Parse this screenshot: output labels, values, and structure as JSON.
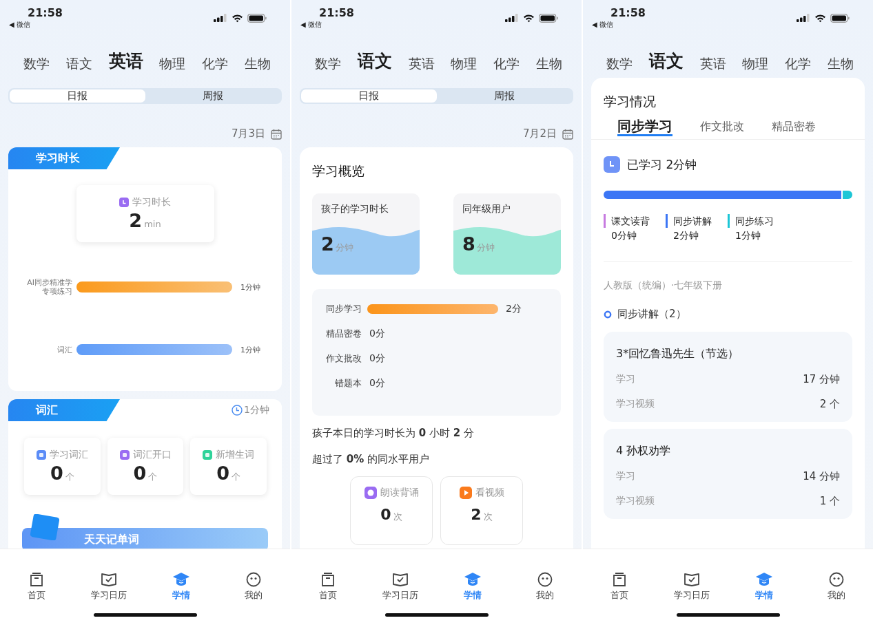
{
  "screens": [
    {
      "status_bar": {
        "time": "21:58",
        "back": "◀ 微信"
      },
      "subjects": [
        {
          "label": "数学",
          "selected": false
        },
        {
          "label": "语文",
          "selected": false
        },
        {
          "label": "英语",
          "selected": true
        },
        {
          "label": "物理",
          "selected": false
        },
        {
          "label": "化学",
          "selected": false
        },
        {
          "label": "生物",
          "selected": false
        }
      ],
      "report_tabs": [
        {
          "label": "日报",
          "selected": true
        },
        {
          "label": "周报",
          "selected": false
        }
      ],
      "date": "7月3日",
      "duration_card": {
        "tag": "学习时长",
        "stat_label": "学习时长",
        "stat_value": "2",
        "stat_unit": "min",
        "bars": [
          {
            "label_lines": [
              "AI同步精准学",
              "专项练习"
            ],
            "level": 1,
            "value": "1分钟",
            "color": "#fb9a1c"
          },
          {
            "label_lines": [
              "词汇"
            ],
            "level": 1,
            "value": "1分钟",
            "color": "#5f9cf8"
          }
        ]
      },
      "vocab_card": {
        "tag": "词汇",
        "time": "1分钟",
        "stats": [
          {
            "kind": "book",
            "label": "学习词汇",
            "value": "0",
            "unit": "个"
          },
          {
            "kind": "mouth",
            "label": "词汇开口",
            "value": "0",
            "unit": "个"
          },
          {
            "kind": "new",
            "label": "新增生词",
            "value": "0",
            "unit": "个"
          }
        ],
        "banner": "天天记单词"
      },
      "nav": [
        {
          "kind": "home",
          "label": "首页",
          "selected": false
        },
        {
          "kind": "book",
          "label": "学习日历",
          "selected": false
        },
        {
          "kind": "cap",
          "label": "学情",
          "selected": true
        },
        {
          "kind": "face",
          "label": "我的",
          "selected": false
        }
      ]
    },
    {
      "status_bar": {
        "time": "21:58",
        "back": "◀ 微信"
      },
      "subjects": [
        {
          "label": "数学",
          "selected": false
        },
        {
          "label": "语文",
          "selected": true
        },
        {
          "label": "英语",
          "selected": false
        },
        {
          "label": "物理",
          "selected": false
        },
        {
          "label": "化学",
          "selected": false
        },
        {
          "label": "生物",
          "selected": false
        }
      ],
      "report_tabs": [
        {
          "label": "日报",
          "selected": true
        },
        {
          "label": "周报",
          "selected": false
        }
      ],
      "date": "7月2日",
      "overview": {
        "title": "学习概览",
        "tiles": [
          {
            "label": "孩子的学习时长",
            "value": "2",
            "unit": "分钟",
            "color": "#9ccaf3"
          },
          {
            "label": "同年级用户",
            "value": "8",
            "unit": "分钟",
            "color": "#9ee9d8"
          }
        ],
        "rows": [
          {
            "label": "同步学习",
            "level": 1,
            "value": "2分"
          },
          {
            "label": "精品密卷",
            "value": "0分"
          },
          {
            "label": "作文批改",
            "value": "0分"
          },
          {
            "label": "错题本",
            "value": "0分"
          }
        ],
        "summary": [
          "孩子本日的学习时长为 **0** 小时 **2** 分",
          "超过了 **0%** 的同水平用户"
        ],
        "activities": [
          {
            "kind": "read",
            "label": "朗读背诵",
            "value": "0",
            "unit": "次"
          },
          {
            "kind": "video",
            "label": "看视频",
            "value": "2",
            "unit": "次"
          }
        ]
      },
      "nav": [
        {
          "kind": "home",
          "label": "首页",
          "selected": false
        },
        {
          "kind": "book",
          "label": "学习日历",
          "selected": false
        },
        {
          "kind": "cap",
          "label": "学情",
          "selected": true
        },
        {
          "kind": "face",
          "label": "我的",
          "selected": false
        }
      ]
    },
    {
      "status_bar": {
        "time": "21:58",
        "back": "◀ 微信"
      },
      "subjects": [
        {
          "label": "数学",
          "selected": false
        },
        {
          "label": "语文",
          "selected": true
        },
        {
          "label": "英语",
          "selected": false
        },
        {
          "label": "物理",
          "selected": false
        },
        {
          "label": "化学",
          "selected": false
        },
        {
          "label": "生物",
          "selected": false
        }
      ],
      "situation": {
        "title": "学习情况",
        "tabs": [
          {
            "label": "同步学习",
            "selected": true
          },
          {
            "label": "作文批改",
            "selected": false
          },
          {
            "label": "精品密卷",
            "selected": false
          }
        ],
        "studied": "已学习 2分钟",
        "segments": [
          {
            "label": "课文读背",
            "value": "0分钟",
            "color": "#c77be0",
            "level": 0
          },
          {
            "label": "同步讲解",
            "value": "2分钟",
            "color": "#3c76f5",
            "level": 0.955
          },
          {
            "label": "同步练习",
            "value": "1分钟",
            "color": "#1cc6d6",
            "level": 0.045
          }
        ],
        "textbook": "人教版（统编）·七年级下册",
        "group": "同步讲解（2）",
        "lessons": [
          {
            "title": "3*回忆鲁迅先生（节选）",
            "rows": [
              {
                "label": "学习",
                "value": "17 分钟"
              },
              {
                "label": "学习视频",
                "value": "2 个"
              }
            ]
          },
          {
            "title": "4 孙权劝学",
            "rows": [
              {
                "label": "学习",
                "value": "14 分钟"
              },
              {
                "label": "学习视频",
                "value": "1 个"
              }
            ]
          }
        ]
      },
      "nav": [
        {
          "kind": "home",
          "label": "首页",
          "selected": false
        },
        {
          "kind": "book",
          "label": "学习日历",
          "selected": false
        },
        {
          "kind": "cap",
          "label": "学情",
          "selected": true
        },
        {
          "kind": "face",
          "label": "我的",
          "selected": false
        }
      ]
    }
  ]
}
